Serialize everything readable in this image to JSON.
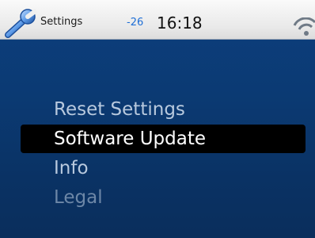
{
  "status_bar": {
    "app_title": "Settings",
    "signal_value": "-26",
    "time": "16:18",
    "app_icon": "wrench-icon",
    "connection_icon": "wifi-icon"
  },
  "menu": {
    "items": [
      {
        "label": "Reset Settings",
        "state": "enabled"
      },
      {
        "label": "Software Update",
        "state": "selected"
      },
      {
        "label": "Info",
        "state": "enabled"
      },
      {
        "label": "Legal",
        "state": "disabled"
      }
    ]
  },
  "colors": {
    "background": "#0b3a73",
    "status_bar": "#efefef",
    "selection": "#000000",
    "menu_text": "#b8c9de",
    "disabled_text": "#6d87a7",
    "signal_text": "#1f6fd6"
  }
}
